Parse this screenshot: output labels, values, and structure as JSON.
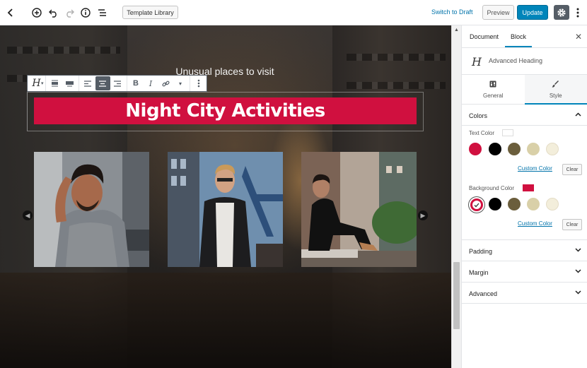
{
  "toolbar": {
    "template_library": "Template Library",
    "switch_to_draft": "Switch to Draft",
    "preview": "Preview",
    "update": "Update"
  },
  "canvas": {
    "subtitle": "Unusual places to visit",
    "heading": "Night City Activities"
  },
  "block_toolbar": {
    "items": [
      "heading-type",
      "align-wide",
      "align-full",
      "align-left",
      "align-center",
      "align-right",
      "bold",
      "italic",
      "link",
      "more-rich-text",
      "more-options"
    ]
  },
  "sidebar": {
    "tabs": [
      "Document",
      "Block"
    ],
    "block_name": "Advanced Heading",
    "sub_tabs": [
      "General",
      "Style"
    ],
    "colors_title": "Colors",
    "text_color_label": "Text Color",
    "background_color_label": "Background Color",
    "custom_color": "Custom Color",
    "clear": "Clear",
    "panels": [
      "Padding",
      "Margin",
      "Advanced"
    ]
  },
  "colors": {
    "accent": "#d0103f",
    "primary_button": "#0085ba",
    "swatches": [
      "#d0103f",
      "#000000",
      "#6b5e3c",
      "#d9d0a8",
      "#f3eedb"
    ],
    "text_color_value": "#ffffff",
    "background_color_value": "#d0103f"
  }
}
